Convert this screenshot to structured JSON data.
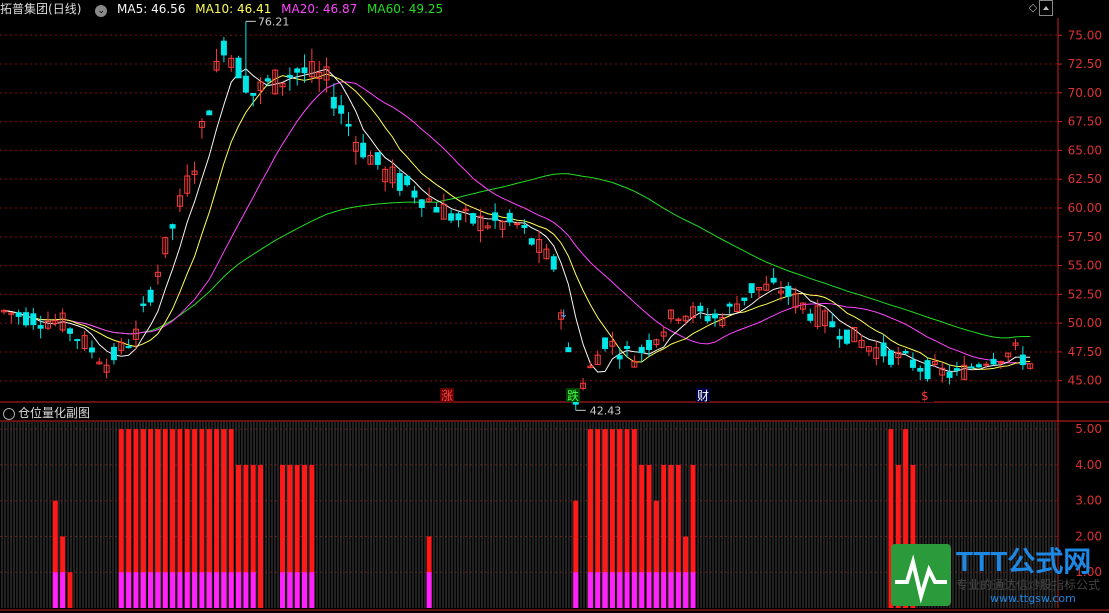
{
  "header": {
    "stock_name": "拓普集团",
    "period": "(日线)",
    "ma5": "MA5: 46.56",
    "ma10": "MA10: 46.41",
    "ma20": "MA20: 46.87",
    "ma60": "MA60: 49.25"
  },
  "sub_header": {
    "title": "仓位量化副图"
  },
  "markers": {
    "high": "76.21",
    "low": "42.43",
    "zhang": "涨",
    "die": "跌",
    "cai": "财",
    "dollar": "$",
    "arrow": "↓"
  },
  "watermark": {
    "text1": "TTT公式网",
    "text2": "专业的通达信炒股指标公式",
    "text3": "www.ttgsw.com"
  },
  "colors": {
    "up": "#ff3c3c",
    "down": "#00e5e5",
    "ma5": "#f5f5f5",
    "ma10": "#ffff55",
    "ma20": "#ff44ff",
    "ma60": "#22dd22",
    "grid": "#7a1010",
    "axis": "#cc2222"
  },
  "chart_data": [
    {
      "type": "candlestick",
      "title": "拓普集团(日线)",
      "y_ticks": [
        "75.00",
        "72.50",
        "70.00",
        "67.50",
        "65.00",
        "62.50",
        "60.00",
        "57.50",
        "55.00",
        "52.50",
        "50.00",
        "47.50",
        "45.00"
      ],
      "ylim": [
        43.5,
        76.5
      ],
      "annotations": [
        {
          "label": "76.21",
          "value": 76.21
        },
        {
          "label": "42.43",
          "value": 42.43
        }
      ],
      "ma": {
        "ma5": 46.56,
        "ma10": 46.41,
        "ma20": 46.87,
        "ma60": 49.25
      }
    },
    {
      "type": "bar",
      "title": "仓位量化副图",
      "y_ticks": [
        "5.00",
        "4.00",
        "3.00",
        "2.00",
        "1.00"
      ],
      "ylim": [
        0,
        5.2
      ],
      "series": [
        {
          "name": "red",
          "segments": [
            {
              "start": 7,
              "values": [
                3,
                2,
                1
              ]
            },
            {
              "start": 16,
              "values": [
                5,
                5,
                5,
                5,
                5,
                5,
                5,
                5,
                5,
                5,
                5,
                5,
                5,
                5,
                5,
                5,
                4,
                4,
                4,
                4
              ]
            },
            {
              "start": 38,
              "values": [
                4,
                4,
                4,
                4,
                4
              ]
            },
            {
              "start": 58,
              "values": [
                2
              ]
            },
            {
              "start": 78,
              "values": [
                3
              ]
            },
            {
              "start": 80,
              "values": [
                5,
                5,
                5,
                5,
                5,
                5,
                5,
                4,
                4,
                3,
                4,
                4,
                4,
                2,
                4
              ]
            },
            {
              "start": 121,
              "values": [
                5,
                4,
                5,
                4
              ]
            }
          ]
        },
        {
          "name": "magenta",
          "segments": [
            {
              "start": 7,
              "values": [
                1,
                1
              ]
            },
            {
              "start": 16,
              "values": [
                1,
                1,
                1,
                1,
                1,
                1,
                1,
                1,
                1,
                1,
                1,
                1,
                1,
                1,
                1,
                1,
                1,
                1,
                1
              ]
            },
            {
              "start": 38,
              "values": [
                1,
                1,
                1,
                1,
                1
              ]
            },
            {
              "start": 58,
              "values": [
                1
              ]
            },
            {
              "start": 78,
              "values": [
                1
              ]
            },
            {
              "start": 80,
              "values": [
                1,
                1,
                1,
                1,
                1,
                1,
                1,
                1,
                1,
                1,
                1,
                1,
                1,
                1,
                1
              ]
            }
          ]
        }
      ]
    }
  ]
}
